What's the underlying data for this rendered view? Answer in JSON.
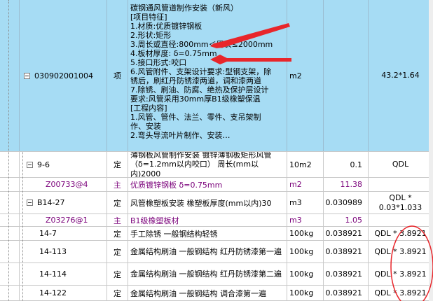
{
  "rows": [
    {
      "code": "030902001004",
      "type": "项",
      "desc_lines": [
        "碳钢通风管道制作安装（新风）",
        "[项目特征]",
        "1.材质:优质镀锌钢板",
        "2.形状:矩形",
        "3.周长或直径:800mm＜周长≤2000mm",
        "4.板材厚度: δ=0.75mm",
        "5.接口形式:咬口",
        "6.风管附件、支架设计要求:型钢支架，除",
        "锈后，刷红丹防锈漆两道，调和漆两道",
        "7.除锈、刷油、防腐、绝热及保护层设计",
        "要求:风管采用30mm厚B1级橡塑保温",
        "[工程内容]",
        "1.风管、管件、法兰、零件、支吊架制",
        "作、安装",
        "2.弯头导流叶片制作、安装…"
      ],
      "unit": "m2",
      "qty": "",
      "expr": "43.2*1.64"
    },
    {
      "code": "9-6",
      "type": "定",
      "name": "薄钢板风管制作安装 镀锌薄钢板矩形风管（δ=1.2mm以内咬口） 周长(mm以内)2000",
      "unit": "10m2",
      "qty": "0.1",
      "expr": "QDL"
    },
    {
      "code": "Z00733@4",
      "type": "主",
      "name": "优质镀锌钢板 δ=0.75mm",
      "unit": "m2",
      "qty": "11.38",
      "expr": ""
    },
    {
      "code": "B14-27",
      "type": "定",
      "name": "风管橡塑板安装 橡塑板厚度(mm以内)30",
      "unit": "m3",
      "qty": "0.030989",
      "expr": "QDL * 0.03*1.033"
    },
    {
      "code": "Z03276@1",
      "type": "主",
      "name": "B1级橡塑板材",
      "unit": "m3",
      "qty": "1.05",
      "expr": ""
    },
    {
      "code": "14-7",
      "type": "定",
      "name": "手工除锈 一般钢结构轻锈",
      "unit": "100kg",
      "qty": "0.038921",
      "expr": "QDL * 3.8921"
    },
    {
      "code": "14-113",
      "type": "定",
      "name": "金属结构刷油 一般钢结构 红丹防锈漆第一遍",
      "unit": "100kg",
      "qty": "0.038921",
      "expr": "QDL * 3.8921"
    },
    {
      "code": "14-114",
      "type": "定",
      "name": "金属结构刷油 一般钢结构 红丹防锈漆第二遍",
      "unit": "100kg",
      "qty": "0.038921",
      "expr": "QDL * 3.8921"
    },
    {
      "code": "14-122",
      "type": "定",
      "name": "金属结构刷油 一般钢结构 调合漆第一遍",
      "unit": "100kg",
      "qty": "0.038921",
      "expr": "QDL * 3.8921"
    }
  ],
  "colors": {
    "selected_row": "#a6dcf4",
    "main_material_text": "#7a007a",
    "annotation": "#e8262b"
  }
}
